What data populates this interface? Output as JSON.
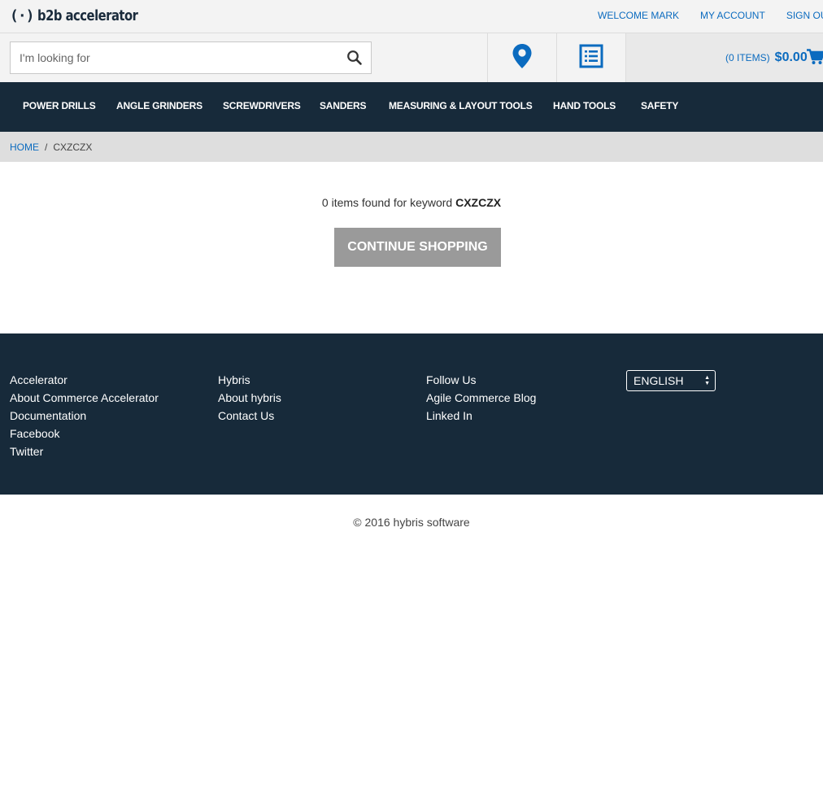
{
  "brand": {
    "logo_mark": "(·)",
    "logo_text": "b2b accelerator"
  },
  "header": {
    "links": [
      {
        "label": "WELCOME MARK"
      },
      {
        "label": "MY ACCOUNT"
      },
      {
        "label": "SIGN OUT"
      }
    ]
  },
  "search": {
    "placeholder": "I'm looking for",
    "value": "",
    "icon": "search-icon"
  },
  "store_finder": {
    "icon": "map-pin-icon"
  },
  "quick_order": {
    "icon": "list-icon"
  },
  "cart": {
    "items_label": "(0 ITEMS)",
    "total": "$0.00",
    "icon": "cart-icon"
  },
  "nav": {
    "items": [
      {
        "label": "POWER DRILLS"
      },
      {
        "label": "ANGLE GRINDERS"
      },
      {
        "label": "SCREWDRIVERS"
      },
      {
        "label": "SANDERS"
      },
      {
        "label": "MEASURING & LAYOUT TOOLS"
      },
      {
        "label": "HAND TOOLS"
      },
      {
        "label": "SAFETY"
      }
    ]
  },
  "breadcrumb": {
    "home": "HOME",
    "separator": "/",
    "current": "CXZCZX"
  },
  "results": {
    "prefix": "0 items found for keyword",
    "keyword": "CXZCZX",
    "continue_label": "CONTINUE SHOPPING"
  },
  "footer": {
    "columns": [
      {
        "links": [
          "Accelerator",
          "About Commerce Accelerator",
          "Documentation",
          "Facebook",
          "Twitter"
        ]
      },
      {
        "links": [
          "Hybris",
          "About hybris",
          "Contact Us"
        ]
      },
      {
        "links": [
          "Follow Us",
          "Agile Commerce Blog",
          "Linked In"
        ]
      }
    ],
    "language": "ENGLISH",
    "copyright": "© 2016 hybris software"
  },
  "colors": {
    "nav_bg": "#172a3a",
    "link_blue": "#0b6bbf",
    "button_grey": "#9a9a9a"
  }
}
